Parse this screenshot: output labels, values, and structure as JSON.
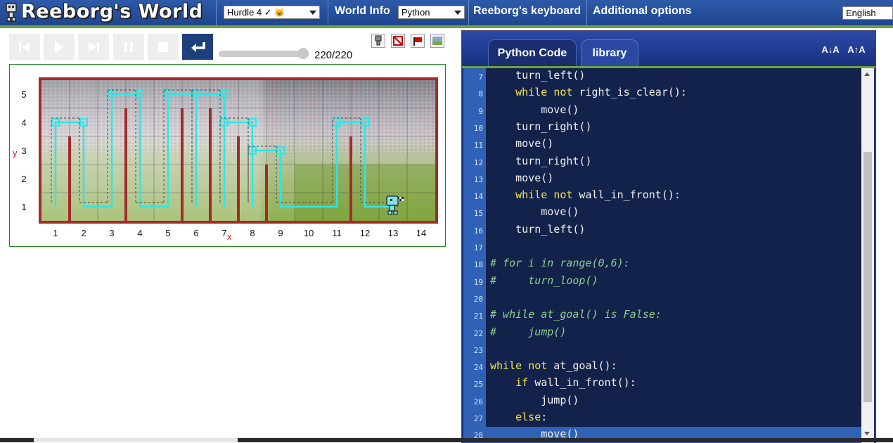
{
  "topbar": {
    "title": "Reeborg's World",
    "world_select": "Hurdle 4 ✓",
    "world_info": "World Info",
    "language_select": "Python",
    "keyboard": "Reeborg's keyboard",
    "additional": "Additional options",
    "human_lang": "English"
  },
  "controls": {
    "icons": [
      "step-back-icon",
      "play-icon",
      "step-forward-icon",
      "pause-icon",
      "stop-icon",
      "reload-icon"
    ],
    "step_counter": "220/220",
    "slider_fraction": 1.0
  },
  "world": {
    "x_labels": [
      "1",
      "2",
      "3",
      "4",
      "5",
      "6",
      "7",
      "8",
      "9",
      "10",
      "11",
      "12",
      "13",
      "14"
    ],
    "y_labels": [
      "1",
      "2",
      "3",
      "4",
      "5"
    ],
    "x_axis": "x",
    "y_axis": "y",
    "columns": 14,
    "rows": 5,
    "walls_east": [
      {
        "x": 1,
        "height": 3
      },
      {
        "x": 3,
        "height": 4
      },
      {
        "x": 5,
        "height": 4
      },
      {
        "x": 6,
        "height": 4
      },
      {
        "x": 7,
        "height": 3
      },
      {
        "x": 8,
        "height": 2
      },
      {
        "x": 11,
        "height": 3
      }
    ],
    "robot": {
      "x": 13,
      "y": 1
    },
    "goal": {
      "x": 13,
      "y": 1
    },
    "colors": {
      "wall": "#a52a2a",
      "trace": "#2ee6e6",
      "accent": "#6aa43a"
    }
  },
  "editor": {
    "tabs": [
      "Python Code",
      "library"
    ],
    "font_buttons": [
      "A↓A",
      "A↑A"
    ],
    "active_line": 28,
    "lines": [
      {
        "n": 7,
        "code": "    turn_left()"
      },
      {
        "n": 8,
        "code": "    while not right_is_clear():"
      },
      {
        "n": 9,
        "code": "        move()"
      },
      {
        "n": 10,
        "code": "    turn_right()"
      },
      {
        "n": 11,
        "code": "    move()"
      },
      {
        "n": 12,
        "code": "    turn_right()"
      },
      {
        "n": 13,
        "code": "    move()"
      },
      {
        "n": 14,
        "code": "    while not wall_in_front():"
      },
      {
        "n": 15,
        "code": "        move()"
      },
      {
        "n": 16,
        "code": "    turn_left()"
      },
      {
        "n": 17,
        "code": ""
      },
      {
        "n": 18,
        "code": "# for i in range(0,6):"
      },
      {
        "n": 19,
        "code": "#     turn_loop()"
      },
      {
        "n": 20,
        "code": ""
      },
      {
        "n": 21,
        "code": "# while at_goal() is False:"
      },
      {
        "n": 22,
        "code": "#     jump()"
      },
      {
        "n": 23,
        "code": ""
      },
      {
        "n": 24,
        "code": "while not at_goal():"
      },
      {
        "n": 25,
        "code": "    if wall_in_front():"
      },
      {
        "n": 26,
        "code": "        jump()"
      },
      {
        "n": 27,
        "code": "    else:"
      },
      {
        "n": 28,
        "code": "        move()"
      }
    ]
  }
}
